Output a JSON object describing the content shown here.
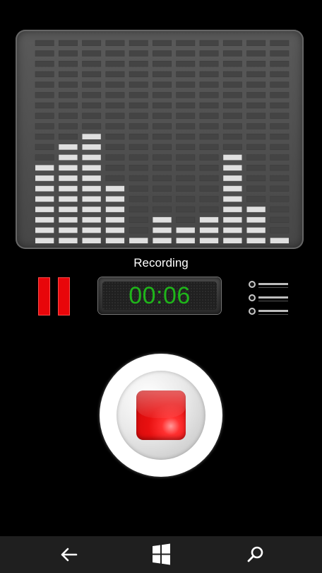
{
  "equalizer": {
    "column_count": 11,
    "max_segments": 20,
    "column_levels": [
      8,
      10,
      11,
      6,
      1,
      3,
      2,
      3,
      9,
      4,
      1
    ],
    "grid_color": "#444444",
    "bar_color": "#e0e0e0"
  },
  "status": {
    "label": "Recording"
  },
  "controls": {
    "pause_color": "#e8060a",
    "timer": "00:06",
    "timer_color": "#1fb51a",
    "list_icon": "list-icon"
  },
  "record": {
    "button_icon": "stop-icon",
    "accent_color": "#e81010"
  },
  "nav": {
    "back_icon": "back-arrow-icon",
    "home_icon": "windows-start-icon",
    "search_icon": "search-icon"
  }
}
